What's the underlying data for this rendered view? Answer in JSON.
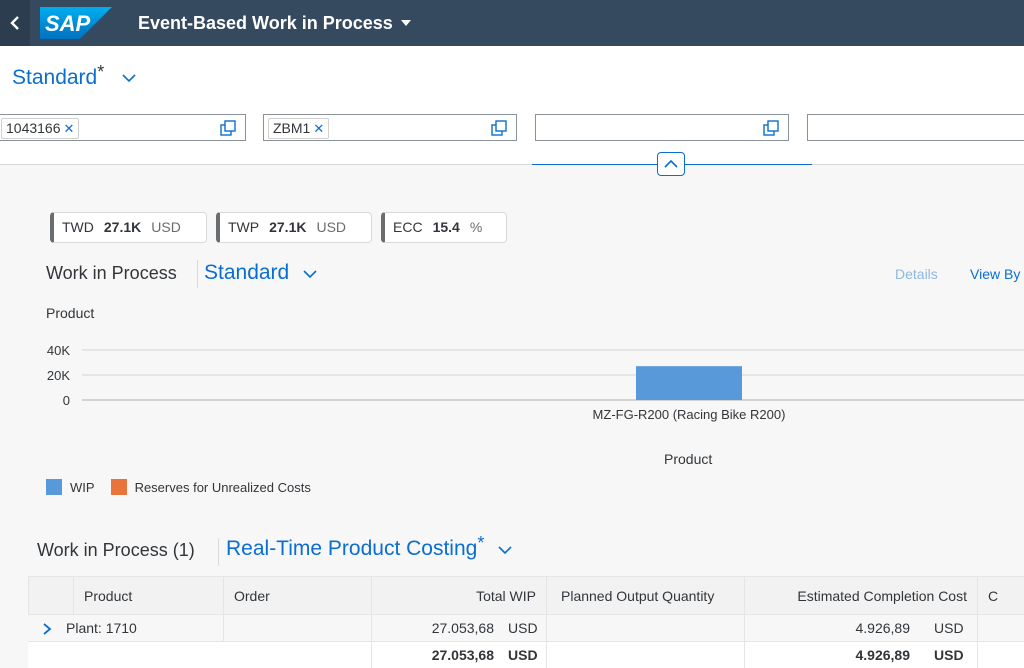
{
  "shell": {
    "app_title": "Event-Based Work in Process",
    "logo_text": "SAP"
  },
  "header": {
    "variant": "Standard",
    "variant_dirty": "*",
    "filters": [
      {
        "token": "1043166",
        "placeholder": ""
      },
      {
        "token": "ZBM1",
        "placeholder": ""
      },
      {
        "token": "",
        "placeholder": ""
      },
      {
        "token": "",
        "placeholder": ""
      }
    ]
  },
  "kpis": [
    {
      "label": "TWD",
      "value": "27.1K",
      "unit": "USD"
    },
    {
      "label": "TWP",
      "value": "27.1K",
      "unit": "USD"
    },
    {
      "label": "ECC",
      "value": "15.4",
      "unit": "%"
    }
  ],
  "chart_section": {
    "title": "Work in Process",
    "variant": "Standard",
    "details_label": "Details",
    "view_by_label": "View By"
  },
  "chart_data": {
    "type": "bar",
    "title": "Product",
    "xlabel": "Product",
    "ylabel": "",
    "categories": [
      "MZ-FG-R200 (Racing Bike R200)"
    ],
    "series": [
      {
        "name": "WIP",
        "values": [
          27053.68
        ],
        "color": "#5899da"
      },
      {
        "name": "Reserves for Unrealized Costs",
        "values": [
          0
        ],
        "color": "#e8743b"
      }
    ],
    "yticks": [
      "0",
      "20K",
      "40K"
    ],
    "ylim": [
      0,
      40000
    ],
    "legend_position": "bottom-left",
    "grid": true
  },
  "table_section": {
    "title": "Work in Process (1)",
    "variant": "Real-Time Product Costing",
    "variant_dirty": "*",
    "columns": [
      "Product",
      "Order",
      "Total WIP",
      "Planned Output Quantity",
      "Estimated Completion Cost",
      "C"
    ],
    "rows": [
      {
        "group": "Plant: 1710",
        "total_wip": "27.053,68",
        "total_wip_unit": "USD",
        "ecc": "4.926,89",
        "ecc_unit": "USD"
      }
    ],
    "totals": {
      "total_wip": "27.053,68",
      "total_wip_unit": "USD",
      "ecc": "4.926,89",
      "ecc_unit": "USD"
    }
  }
}
